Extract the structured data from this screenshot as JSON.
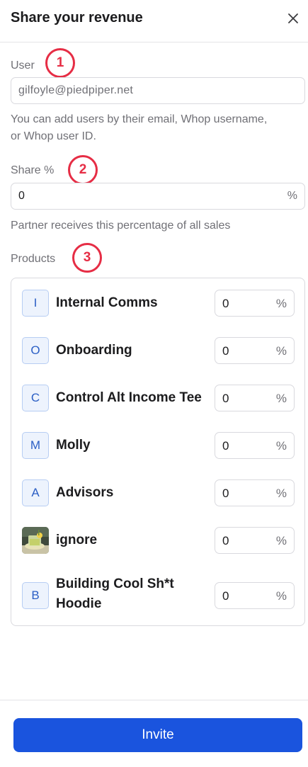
{
  "header": {
    "title": "Share your revenue"
  },
  "user": {
    "label": "User",
    "value": "gilfoyle@piedpiper.net",
    "help_line1": "You can add users by their email, Whop username,",
    "help_line2": "or Whop user ID."
  },
  "share": {
    "label": "Share %",
    "value": "0",
    "suffix": "%",
    "help": "Partner receives this percentage of all sales"
  },
  "products": {
    "label": "Products",
    "items": [
      {
        "initial": "I",
        "name": "Internal Comms",
        "value": "0",
        "suffix": "%"
      },
      {
        "initial": "O",
        "name": "Onboarding",
        "value": "0",
        "suffix": "%"
      },
      {
        "initial": "C",
        "name": "Control Alt Income Tee",
        "value": "0",
        "suffix": "%"
      },
      {
        "initial": "M",
        "name": "Molly",
        "value": "0",
        "suffix": "%"
      },
      {
        "initial": "A",
        "name": "Advisors",
        "value": "0",
        "suffix": "%"
      },
      {
        "initial": "",
        "name": "ignore",
        "value": "0",
        "suffix": "%"
      },
      {
        "initial": "B",
        "name_line1": "Building Cool Sh*t",
        "name_line2": "Hoodie",
        "value": "0",
        "suffix": "%"
      }
    ]
  },
  "annotations": [
    "1",
    "2",
    "3"
  ],
  "footer": {
    "invite_label": "Invite"
  },
  "colors": {
    "accent": "#1a54de",
    "annotation": "#e62d45",
    "tile_bg": "#edf3fd",
    "tile_text": "#2b5fc5"
  }
}
